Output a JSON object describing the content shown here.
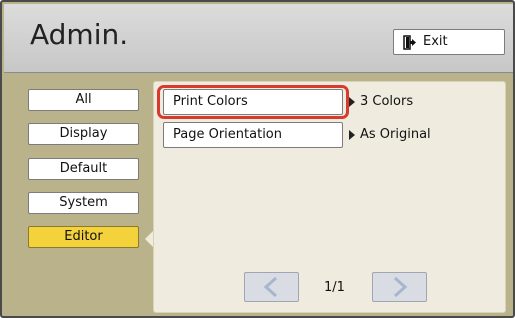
{
  "header": {
    "title": "Admin.",
    "exit_label": "Exit"
  },
  "sidebar": {
    "items": [
      {
        "label": "All",
        "active": false
      },
      {
        "label": "Display",
        "active": false
      },
      {
        "label": "Default",
        "active": false
      },
      {
        "label": "System",
        "active": false
      },
      {
        "label": "Editor",
        "active": true
      }
    ]
  },
  "settings": [
    {
      "label": "Print Colors",
      "value": "3 Colors",
      "selected": true
    },
    {
      "label": "Page Orientation",
      "value": "As Original",
      "selected": false
    }
  ],
  "pagination": {
    "text": "1/1"
  },
  "colors": {
    "active_tab": "#f4d23c",
    "selection_ring": "#d83a2d",
    "background": "#b9b28a"
  }
}
